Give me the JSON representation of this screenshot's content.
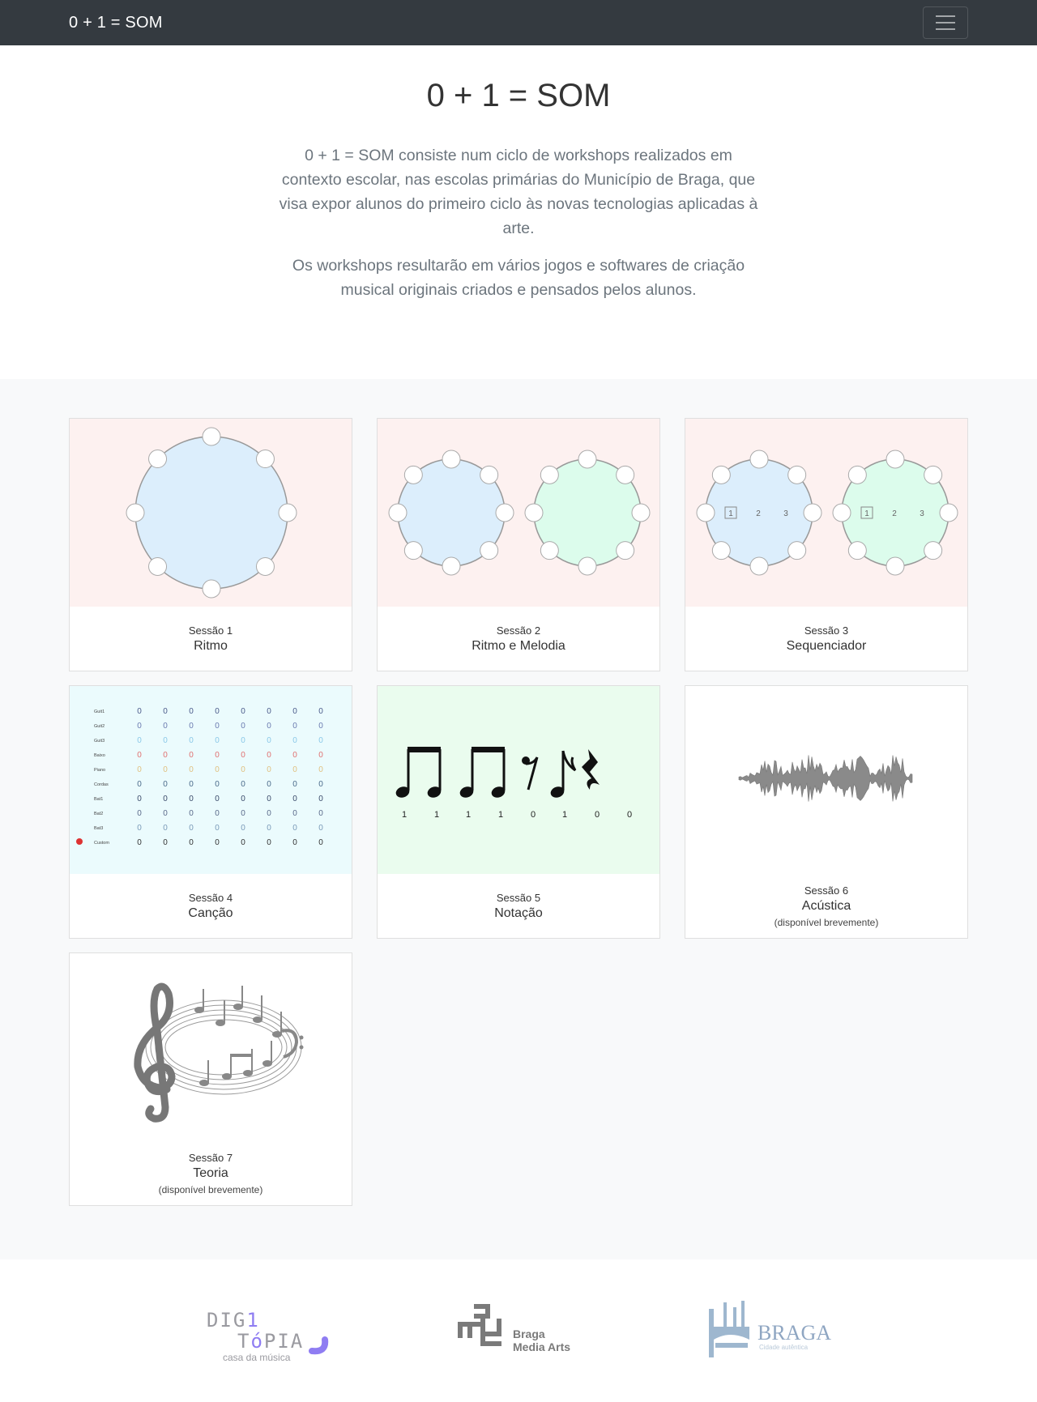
{
  "nav": {
    "brand": "0 + 1 = SOM"
  },
  "hero": {
    "title": "0 + 1 = SOM",
    "paragraph1": "0 + 1 = SOM consiste num ciclo de workshops realizados em contexto escolar, nas escolas primárias do Município de Braga, que visa expor alunos do primeiro ciclo às novas tecnologias aplicadas à arte.",
    "paragraph2": "Os workshops resultarão em vários jogos e softwares de criação musical originais criados e pensados pelos alunos."
  },
  "sessions": [
    {
      "session": "Sessão 1",
      "title": "Ritmo",
      "note": ""
    },
    {
      "session": "Sessão 2",
      "title": "Ritmo e Melodia",
      "note": ""
    },
    {
      "session": "Sessão 3",
      "title": "Sequenciador",
      "note": "",
      "labels": [
        "1",
        "2",
        "3"
      ]
    },
    {
      "session": "Sessão 4",
      "title": "Canção",
      "note": "",
      "rows": [
        "Guit1",
        "Guit2",
        "Guit3",
        "Baixo",
        "Piano",
        "Cordas",
        "Bat1",
        "Bat2",
        "Bat3",
        "Custom"
      ],
      "cell": "0"
    },
    {
      "session": "Sessão 5",
      "title": "Notação",
      "note": "",
      "digits": [
        "1",
        "1",
        "1",
        "1",
        "0",
        "1",
        "0",
        "0"
      ]
    },
    {
      "session": "Sessão 6",
      "title": "Acústica",
      "note": "(disponível brevemente)"
    },
    {
      "session": "Sessão 7",
      "title": "Teoria",
      "note": "(disponível brevemente)"
    }
  ],
  "footer": {
    "logo1": {
      "line1": "DIG",
      "line1b": "1",
      "line2": "T",
      "line2b": "ó",
      "line2c": "PIA",
      "sub": "casa da música"
    },
    "logo2": {
      "line1": "Braga",
      "line2": "Media Arts"
    },
    "logo3": {
      "line1": "BRAGA",
      "sub": "Cidade autêntica"
    }
  },
  "colors": {
    "navbar": "#343a40",
    "circleBlue": "#dceefc",
    "circleGreen": "#dcfcec",
    "pinkBg": "#fdf1f0",
    "accentPurple": "#8f7df2"
  }
}
